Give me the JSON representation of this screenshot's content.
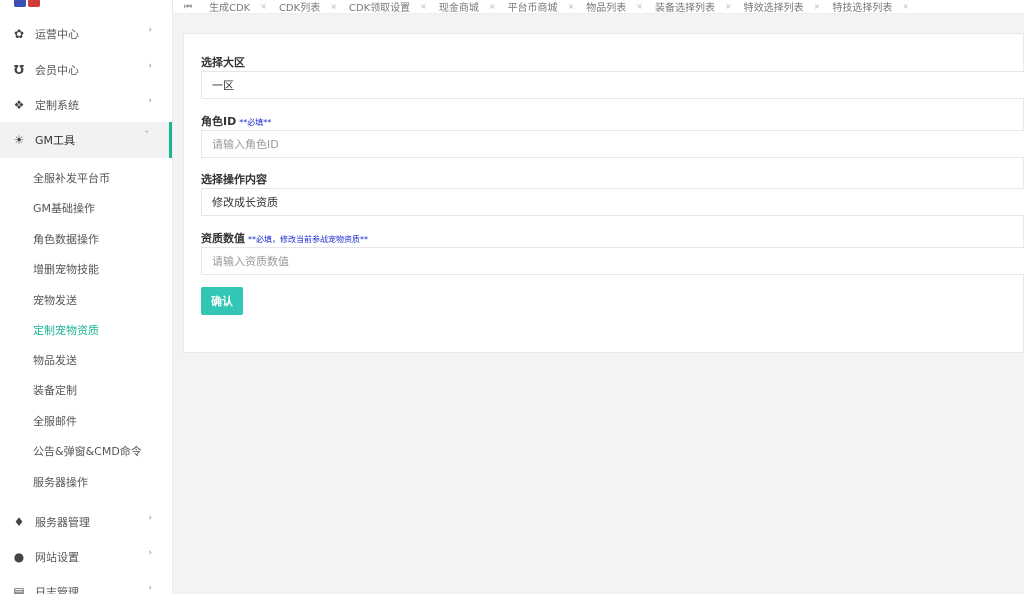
{
  "sidebar": {
    "menus": [
      {
        "label": "运营中心",
        "icon": "gear-icon"
      },
      {
        "label": "会员中心",
        "icon": "magnet-icon"
      },
      {
        "label": "定制系统",
        "icon": "puzzle-icon"
      },
      {
        "label": "GM工具",
        "icon": "lightbulb-icon"
      }
    ],
    "sub_items": [
      "全服补发平台币",
      "GM基础操作",
      "角色数据操作",
      "增删宠物技能",
      "宠物发送",
      "定制宠物资质",
      "物品发送",
      "装备定制",
      "全服邮件",
      "公告&弹窗&CMD命令",
      "服务器操作"
    ],
    "active_sub_index": 5,
    "bottom_menus": [
      {
        "label": "服务器管理",
        "icon": "diamond-icon"
      },
      {
        "label": "网站设置",
        "icon": "globe-icon"
      },
      {
        "label": "日志管理",
        "icon": "document-icon"
      }
    ]
  },
  "tabs": [
    "生成CDK",
    "CDK列表",
    "CDK领取设置",
    "现金商城",
    "平台币商城",
    "物品列表",
    "装备选择列表",
    "特效选择列表",
    "特技选择列表"
  ],
  "form": {
    "region_label": "选择大区",
    "region_value": "一区",
    "role_label": "角色ID",
    "role_required": "**必填**",
    "role_placeholder": "请输入角色ID",
    "operation_label": "选择操作内容",
    "operation_value": "修改成长资质",
    "aptitude_label": "资质数值",
    "aptitude_required": "**必填，修改当前参战宠物资质**",
    "aptitude_placeholder": "请输入资质数值",
    "confirm_label": "确认"
  },
  "colors": {
    "accent": "#1ab394",
    "button": "#33c6b6",
    "required_text": "#1a2ad0"
  }
}
